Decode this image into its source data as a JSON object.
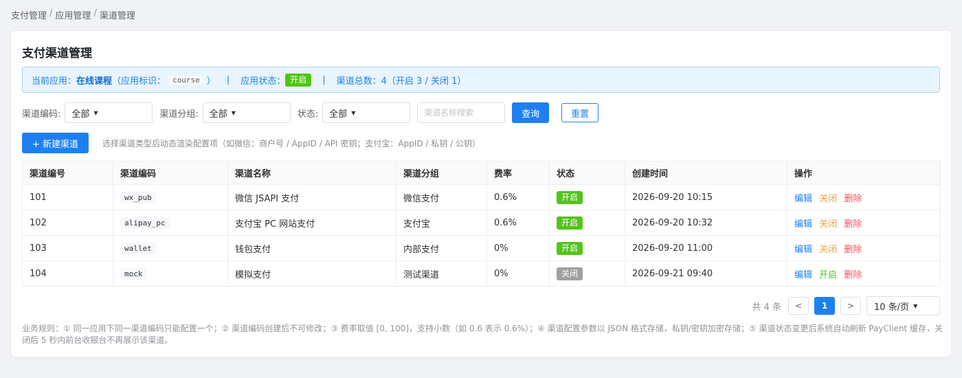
{
  "breadcrumb": [
    "支付管理",
    "应用管理",
    "渠道管理"
  ],
  "page_title": "支付渠道管理",
  "info": {
    "app_label": "当前应用：",
    "app_name": "在线课程",
    "app_id_prefix": "（应用标识：",
    "app_id": "course",
    "app_id_suffix": "）",
    "status_label": "应用状态：",
    "status_value": "开启",
    "total_label": "渠道总数：",
    "total_value": "4（开启 3 / 关闭 1）"
  },
  "filters": {
    "code_label": "渠道编码:",
    "code_value": "全部",
    "group_label": "渠道分组:",
    "group_value": "全部",
    "status_label": "状态:",
    "status_value": "全部",
    "search_placeholder": "渠道名称搜索",
    "query_button": "查询",
    "reset_button": "重置"
  },
  "toolbar": {
    "new_button": "+ 新建渠道",
    "hint": "选择渠道类型后动态渲染配置项（如微信：商户号 / AppID / API 密钥；支付宝：AppID / 私钥 / 公钥）"
  },
  "table": {
    "headers": [
      "渠道编号",
      "渠道编码",
      "渠道名称",
      "渠道分组",
      "费率",
      "状态",
      "创建时间",
      "操作"
    ],
    "rows": [
      {
        "id": "101",
        "code": "wx_pub",
        "name": "微信 JSAPI 支付",
        "group": "微信支付",
        "rate": "0.6%",
        "status": "开启",
        "created": "2026-09-20 10:15",
        "actions": [
          "编辑",
          "关闭",
          "删除"
        ]
      },
      {
        "id": "102",
        "code": "alipay_pc",
        "name": "支付宝 PC 网站支付",
        "group": "支付宝",
        "rate": "0.6%",
        "status": "开启",
        "created": "2026-09-20 10:32",
        "actions": [
          "编辑",
          "关闭",
          "删除"
        ]
      },
      {
        "id": "103",
        "code": "wallet",
        "name": "钱包支付",
        "group": "内部支付",
        "rate": "0%",
        "status": "开启",
        "created": "2026-09-20 11:00",
        "actions": [
          "编辑",
          "关闭",
          "删除"
        ]
      },
      {
        "id": "104",
        "code": "mock",
        "name": "模拟支付",
        "group": "测试渠道",
        "rate": "0%",
        "status": "关闭",
        "created": "2026-09-21 09:40",
        "actions": [
          "编辑",
          "开启",
          "删除"
        ]
      }
    ]
  },
  "pagination": {
    "total": "共 4 条",
    "prev": "<",
    "current": "1",
    "next": ">",
    "page_size": "10 条/页"
  },
  "rules": "业务规则：① 同一应用下同一渠道编码只能配置一个；② 渠道编码创建后不可修改；③ 费率取值 [0, 100]，支持小数（如 0.6 表示 0.6%）；④ 渠道配置参数以 JSON 格式存储，私钥/密钥加密存储；⑤ 渠道状态变更后系统自动刷新 PayClient 缓存，关闭后 5 秒内前台收银台不再展示该渠道。",
  "colors": {
    "primary": "#1e80f0",
    "status_on": "#52c41a",
    "status_off": "#a0a0a0",
    "action_close": "#f7a035",
    "action_delete": "#f5505a"
  }
}
